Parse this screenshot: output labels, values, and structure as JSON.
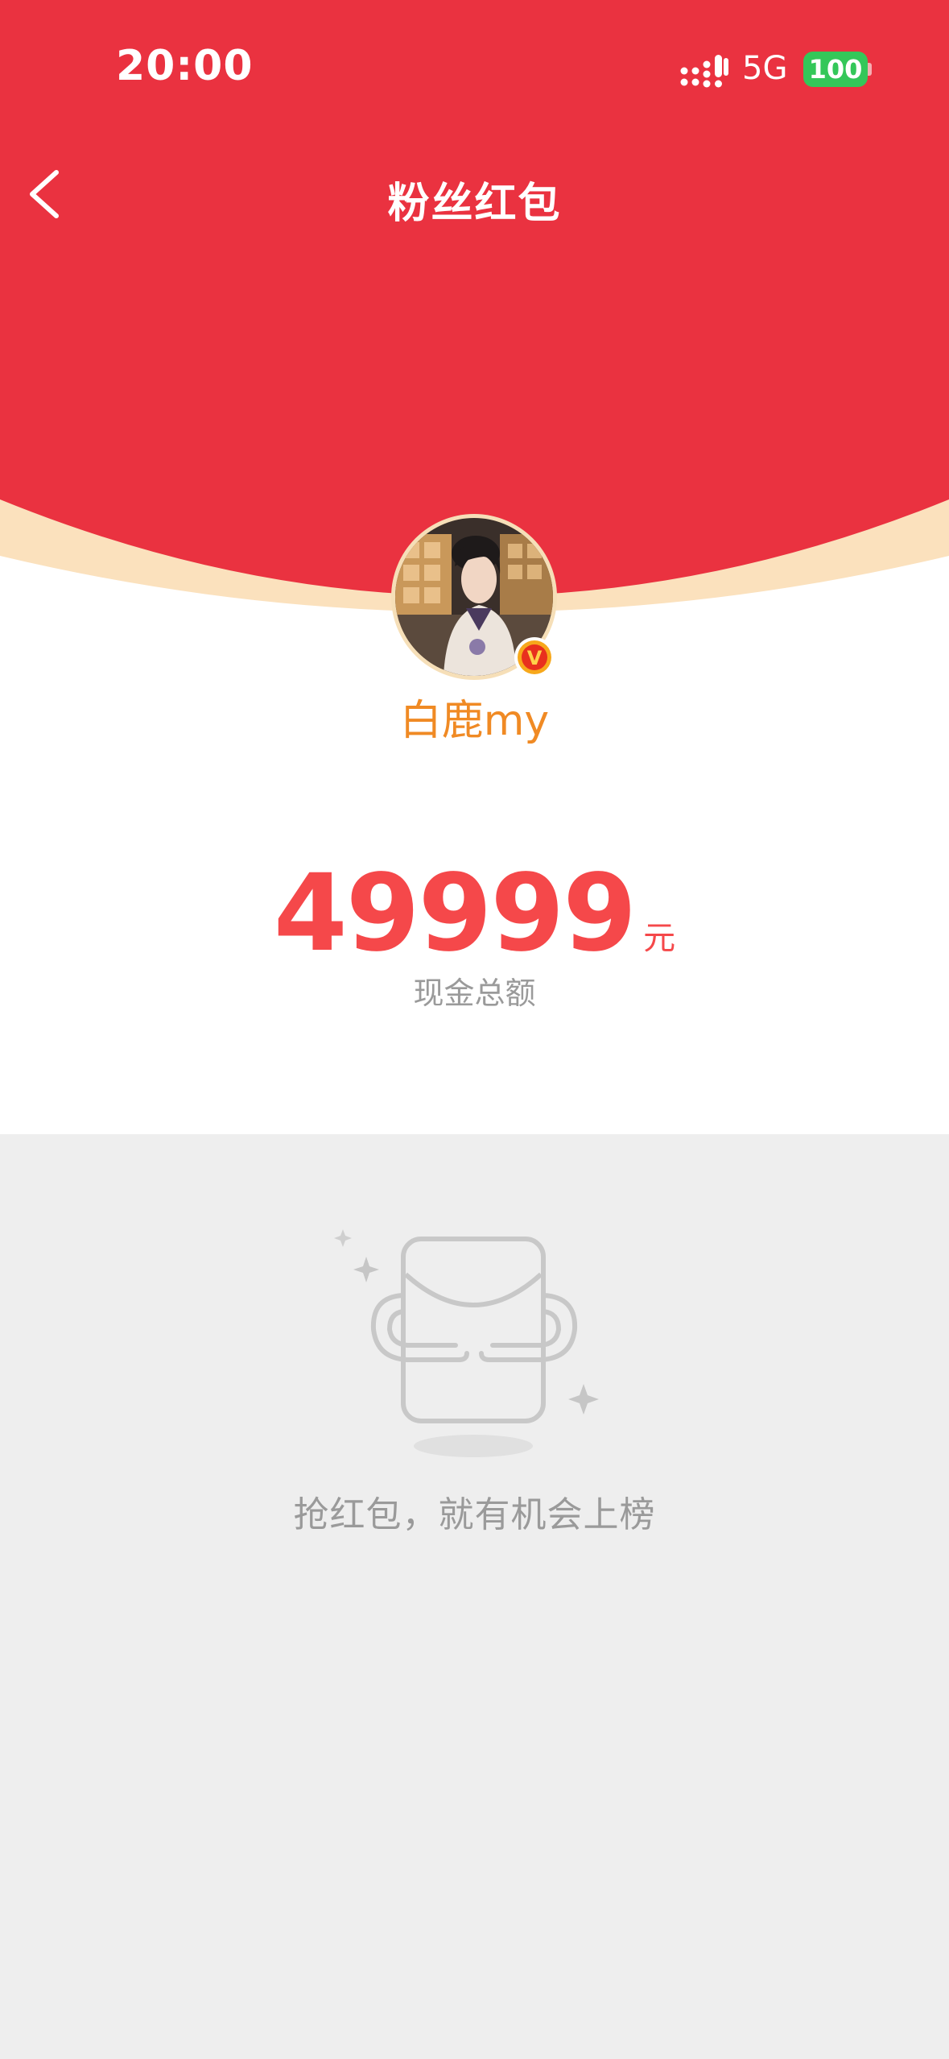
{
  "status_bar": {
    "time": "20:00",
    "network": "5G",
    "battery": "100",
    "signal_icon": "signal-bars-icon"
  },
  "nav": {
    "back_icon": "chevron-left-icon",
    "title": "粉丝红包"
  },
  "profile": {
    "username": "白鹿my",
    "avatar_icon": "avatar",
    "badge_icon": "verified-v-icon",
    "badge_letter": "V"
  },
  "amount": {
    "value": "49999",
    "unit": "元",
    "label": "现金总额"
  },
  "empty_state": {
    "icon": "red-packet-empty-icon",
    "text": "抢红包，就有机会上榜"
  },
  "colors": {
    "header_red": "#ea3240",
    "accent_orange": "#f08a24",
    "amount_red": "#f5484a",
    "battery_green": "#34c759",
    "muted_gray": "#9a9a9a",
    "background_gray": "#eeeeee"
  }
}
